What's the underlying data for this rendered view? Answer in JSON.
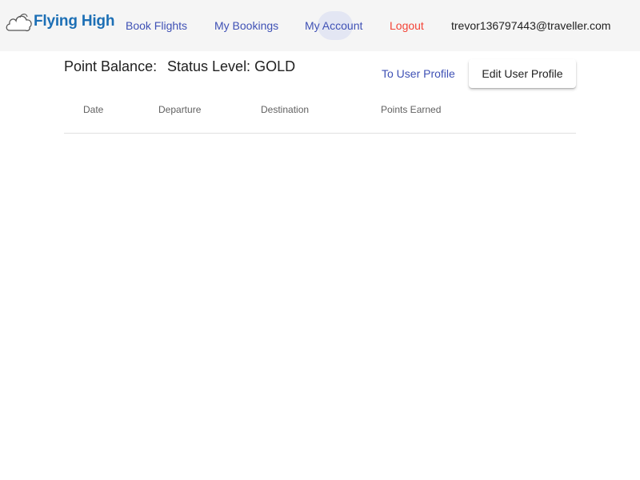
{
  "header": {
    "logo_text": "Flying High",
    "nav": {
      "book_flights": "Book Flights",
      "my_bookings": "My Bookings",
      "my_account": "My Account",
      "logout": "Logout"
    },
    "user_email": "trevor136797443@traveller.com"
  },
  "account": {
    "point_balance_label": "Point Balance:",
    "status_level_label": "Status Level: GOLD",
    "to_user_profile": "To User Profile",
    "edit_user_profile": "Edit User Profile"
  },
  "table": {
    "columns": [
      "Date",
      "Departure",
      "Destination",
      "Points Earned"
    ],
    "rows": []
  },
  "colors": {
    "link": "#3f51b5",
    "logout": "#f44336",
    "header_bg": "#f5f5f5",
    "logo": "#1c6fb5"
  },
  "icons": {
    "logo": "cloud-icon"
  }
}
